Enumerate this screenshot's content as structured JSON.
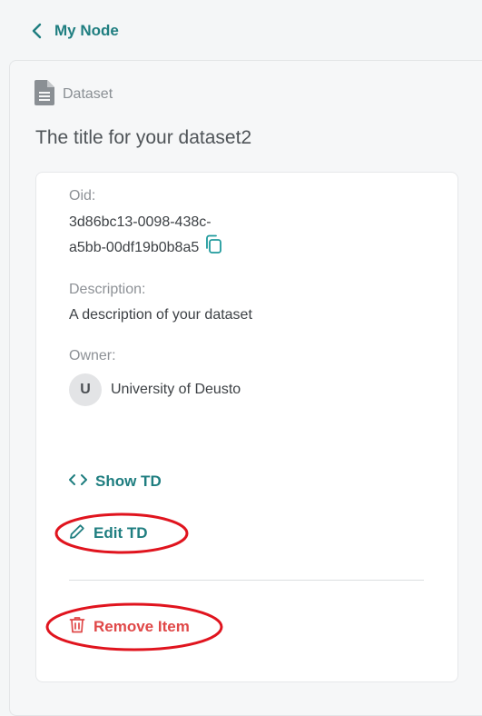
{
  "nav": {
    "back_label": "My Node"
  },
  "item": {
    "type": "Dataset",
    "title": "The title for your dataset2"
  },
  "details": {
    "oid_label": "Oid:",
    "oid_line1": "3d86bc13-0098-438c-",
    "oid_line2": "a5bb-00df19b0b8a5",
    "description_label": "Description:",
    "description": "A description of your dataset",
    "owner_label": "Owner:",
    "owner_initial": "U",
    "owner_name": "University of Deusto"
  },
  "actions": {
    "show_td": "Show TD",
    "edit_td": "Edit TD",
    "remove_item": "Remove Item"
  },
  "colors": {
    "accent": "#1f7e80",
    "danger": "#e04848",
    "annotation": "#e0141e"
  },
  "icons": [
    "chevron-left-icon",
    "document-icon",
    "copy-icon",
    "code-icon",
    "pencil-icon",
    "trash-icon"
  ]
}
